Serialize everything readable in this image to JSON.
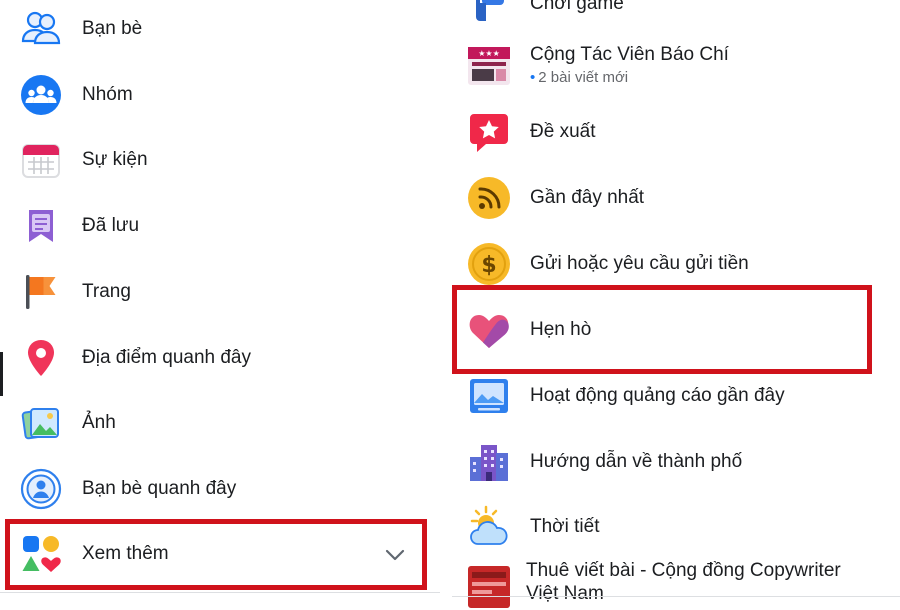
{
  "left_menu": {
    "items": [
      {
        "label": "Bạn bè",
        "icon": "friends-icon"
      },
      {
        "label": "Nhóm",
        "icon": "groups-icon"
      },
      {
        "label": "Sự kiện",
        "icon": "calendar-icon"
      },
      {
        "label": "Đã lưu",
        "icon": "saved-bookmark-icon"
      },
      {
        "label": "Trang",
        "icon": "pages-flag-icon"
      },
      {
        "label": "Địa điểm quanh đây",
        "icon": "location-pin-icon"
      },
      {
        "label": "Ảnh",
        "icon": "photos-icon"
      },
      {
        "label": "Bạn bè quanh đây",
        "icon": "nearby-friends-icon"
      },
      {
        "label": "Xem thêm",
        "icon": "see-more-shapes-icon"
      }
    ]
  },
  "right_menu": {
    "items": [
      {
        "label": "Chơi game",
        "icon": "gaming-icon"
      },
      {
        "label": "Cộng Tác Viên Báo Chí",
        "sub": "2 bài viết mới",
        "icon": "group-thumbnail-icon"
      },
      {
        "label": "Đề xuất",
        "icon": "recommendations-star-icon"
      },
      {
        "label": "Gần đây nhất",
        "icon": "most-recent-feed-icon"
      },
      {
        "label": "Gửi hoặc yêu cầu gửi tiền",
        "icon": "dollar-coin-icon"
      },
      {
        "label": "Hẹn hò",
        "icon": "dating-heart-icon"
      },
      {
        "label": "Hoạt động quảng cáo gần đây",
        "icon": "recent-ad-activity-icon"
      },
      {
        "label": "Hướng dẫn về thành phố",
        "icon": "city-guides-icon"
      },
      {
        "label": "Thời tiết",
        "icon": "weather-icon"
      },
      {
        "label_line1": "Thuê viết bài - Cộng đồng Copywriter",
        "label_line2": "Việt Nam",
        "icon": "group-thumbnail-icon"
      }
    ]
  },
  "colors": {
    "highlight_border": "#d0121b",
    "text": "#1c1e21",
    "secondary_text": "#65676b",
    "accent": "#1877f2"
  }
}
